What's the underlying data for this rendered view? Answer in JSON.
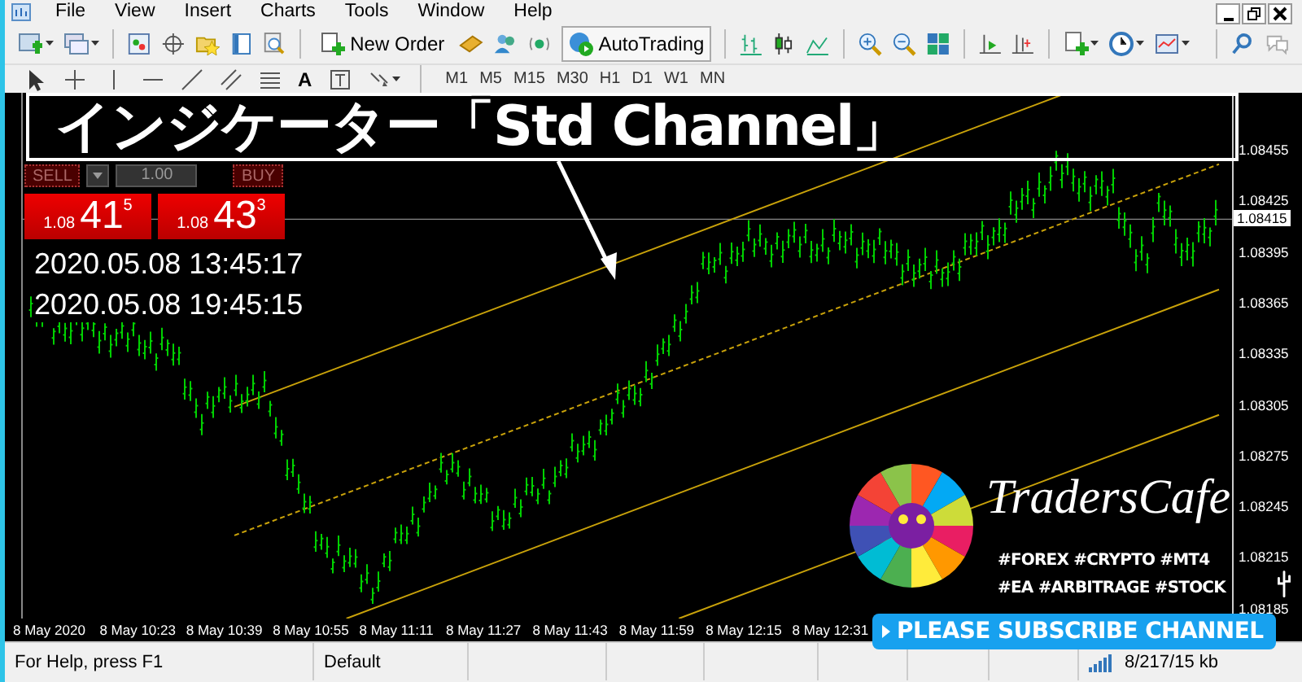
{
  "menu": [
    "File",
    "View",
    "Insert",
    "Charts",
    "Tools",
    "Window",
    "Help"
  ],
  "toolbar": {
    "new_order": "New Order",
    "auto_trading": "AutoTrading"
  },
  "drawing_toolbar": {
    "text_tool": "A",
    "periods": [
      "M1",
      "M5",
      "M15",
      "M30",
      "H1",
      "D1",
      "W1",
      "MN"
    ]
  },
  "overlay_title": "インジケーター「Std Channel」",
  "trade_panel": {
    "sell": "SELL",
    "lot": "1.00",
    "buy": "BUY",
    "bid": {
      "prefix": "1.08",
      "big": "41",
      "small": "5"
    },
    "ask": {
      "prefix": "1.08",
      "big": "43",
      "small": "3"
    }
  },
  "timestamps": [
    "2020.05.08 13:45:17",
    "2020.05.08 19:45:15"
  ],
  "price_axis": {
    "labels": [
      "1.08455",
      "1.08425",
      "1.08395",
      "1.08365",
      "1.08335",
      "1.08305",
      "1.08275",
      "1.08245",
      "1.08215",
      "1.08185"
    ],
    "current": "1.08415"
  },
  "time_axis": [
    "8 May 2020",
    "8 May 10:23",
    "8 May 10:39",
    "8 May 10:55",
    "8 May 11:11",
    "8 May 11:27",
    "8 May 11:43",
    "8 May 11:59",
    "8 May 12:15",
    "8 May 12:31"
  ],
  "branding": {
    "name": "TradersCafe",
    "tags": [
      "#FOREX #CRYPTO #MT4",
      "#EA #ARBITRAGE #STOCK"
    ],
    "subscribe": "PLEASE SUBSCRIBE CHANNEL"
  },
  "status_bar": [
    "For Help, press F1",
    "Default",
    "8/217/15 kb"
  ]
}
